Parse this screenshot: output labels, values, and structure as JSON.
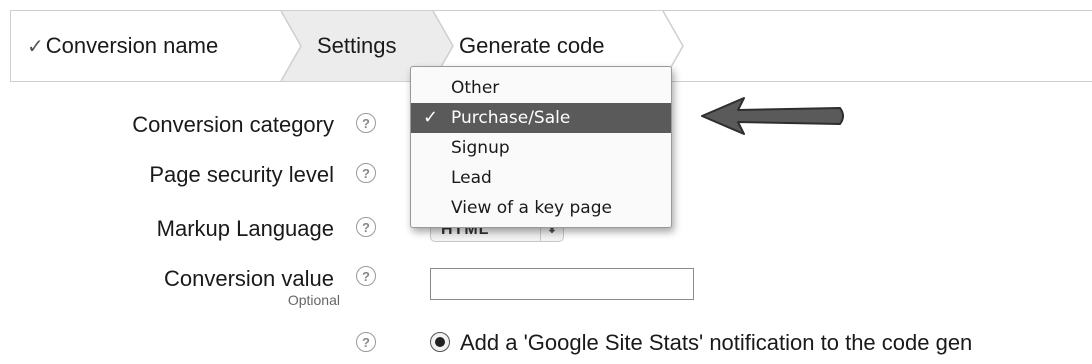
{
  "steps": {
    "done_check": "✓",
    "conversion_name": "Conversion name",
    "settings": "Settings",
    "generate_code": "Generate code"
  },
  "form": {
    "conversion_category_label": "Conversion category",
    "page_security_label": "Page security level",
    "markup_language_label": "Markup Language",
    "markup_language_value": "HTML",
    "conversion_value_label": "Conversion value",
    "conversion_value_hint": "Optional",
    "conversion_value_input": "",
    "help_glyph": "?",
    "notification_label": "Add a 'Google Site Stats' notification to the code gen"
  },
  "dropdown": {
    "options": [
      "Other",
      "Purchase/Sale",
      "Signup",
      "Lead",
      "View of a key page"
    ],
    "selected": "Purchase/Sale",
    "selected_check": "✓"
  },
  "colors": {
    "selected_bg": "#5a5a5a",
    "settings_bg": "#ececec",
    "arrow": "#5a5a5a"
  },
  "icons": {
    "help": "help-icon",
    "check": "check-icon",
    "pointer": "arrow-left-icon"
  }
}
